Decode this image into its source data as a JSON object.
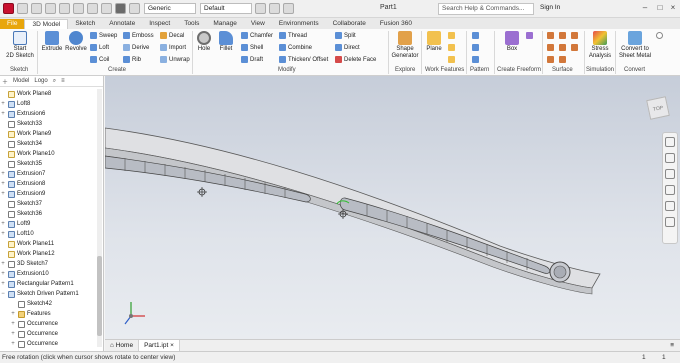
{
  "titlebar": {
    "material": "Generic",
    "appearance": "Default",
    "document_title": "Part1",
    "search_placeholder": "Search Help & Commands...",
    "signin": "Sign In"
  },
  "tabs": [
    "File",
    "3D Model",
    "Sketch",
    "Annotate",
    "Inspect",
    "Tools",
    "Manage",
    "View",
    "Environments",
    "Collaborate",
    "Fusion 360"
  ],
  "ribbon": {
    "sketch": {
      "start": "Start\n2D Sketch",
      "group": "Sketch"
    },
    "create": {
      "extrude": "Extrude",
      "revolve": "Revolve",
      "sweep": "Sweep",
      "loft": "Loft",
      "coil": "Coil",
      "emboss": "Emboss",
      "derive": "Derive",
      "rib": "Rib",
      "decal": "Decal",
      "import": "Import",
      "unwrap": "Unwrap",
      "group": "Create"
    },
    "modify": {
      "hole": "Hole",
      "fillet": "Fillet",
      "chamfer": "Chamfer",
      "shell": "Shell",
      "draft": "Draft",
      "thread": "Thread",
      "combine": "Combine",
      "thicken": "Thicken/ Offset",
      "split": "Split",
      "direct": "Direct",
      "delete_face": "Delete Face",
      "group": "Modify"
    },
    "explore": {
      "shape_generator": "Shape\nGenerator",
      "group": "Explore"
    },
    "work_features": {
      "plane": "Plane",
      "group": "Work Features"
    },
    "pattern": {
      "group": "Pattern"
    },
    "freeform": {
      "box": "Box",
      "group": "Create Freeform"
    },
    "surface": {
      "group": "Surface"
    },
    "simulation": {
      "stress": "Stress\nAnalysis",
      "group": "Simulation"
    },
    "convert": {
      "sheet_metal": "Convert to\nSheet Metal",
      "group": "Convert"
    }
  },
  "browser": {
    "tab_model": "Model",
    "tab_logo": "Logo",
    "items": [
      {
        "label": "Work Plane8",
        "type": "wp",
        "plus": ""
      },
      {
        "label": "Loft8",
        "type": "ft",
        "plus": "+"
      },
      {
        "label": "Extrusion6",
        "type": "ft",
        "plus": "+"
      },
      {
        "label": "Sketch33",
        "type": "sk",
        "plus": ""
      },
      {
        "label": "Work Plane9",
        "type": "wp",
        "plus": ""
      },
      {
        "label": "Sketch34",
        "type": "sk",
        "plus": ""
      },
      {
        "label": "Work Plane10",
        "type": "wp",
        "plus": ""
      },
      {
        "label": "Sketch35",
        "type": "sk",
        "plus": ""
      },
      {
        "label": "Extrusion7",
        "type": "ft",
        "plus": "+"
      },
      {
        "label": "Extrusion8",
        "type": "ft",
        "plus": "+"
      },
      {
        "label": "Extrusion9",
        "type": "ft",
        "plus": "+"
      },
      {
        "label": "Sketch37",
        "type": "sk",
        "plus": ""
      },
      {
        "label": "Sketch36",
        "type": "sk",
        "plus": ""
      },
      {
        "label": "Loft9",
        "type": "ft",
        "plus": "+"
      },
      {
        "label": "Loft10",
        "type": "ft",
        "plus": "+"
      },
      {
        "label": "Work Plane11",
        "type": "wp",
        "plus": ""
      },
      {
        "label": "Work Plane12",
        "type": "wp",
        "plus": ""
      },
      {
        "label": "3D Sketch7",
        "type": "sk",
        "plus": "+"
      },
      {
        "label": "Extrusion10",
        "type": "ft",
        "plus": "+"
      },
      {
        "label": "Rectangular Pattern1",
        "type": "ft",
        "plus": "+"
      },
      {
        "label": "Sketch Driven Pattern1",
        "type": "ft",
        "plus": "−"
      },
      {
        "label": "Sketch42",
        "type": "sk",
        "plus": ""
      },
      {
        "label": "Features",
        "type": "fd",
        "plus": "+"
      },
      {
        "label": "Occurrence",
        "type": "sk",
        "plus": "+"
      },
      {
        "label": "Occurrence",
        "type": "sk",
        "plus": "+"
      },
      {
        "label": "Occurrence",
        "type": "sk",
        "plus": "+"
      }
    ]
  },
  "doc_tabs": {
    "home": "Home",
    "part": "Part1.ipt"
  },
  "status": {
    "text": "Free rotation (click when cursor shows rotate to center view)",
    "n1": "1",
    "n2": "1"
  },
  "colors": {
    "file_tab": "#e8a60c",
    "part_face": "#dcdde0",
    "part_edge": "#5a5a5a"
  }
}
